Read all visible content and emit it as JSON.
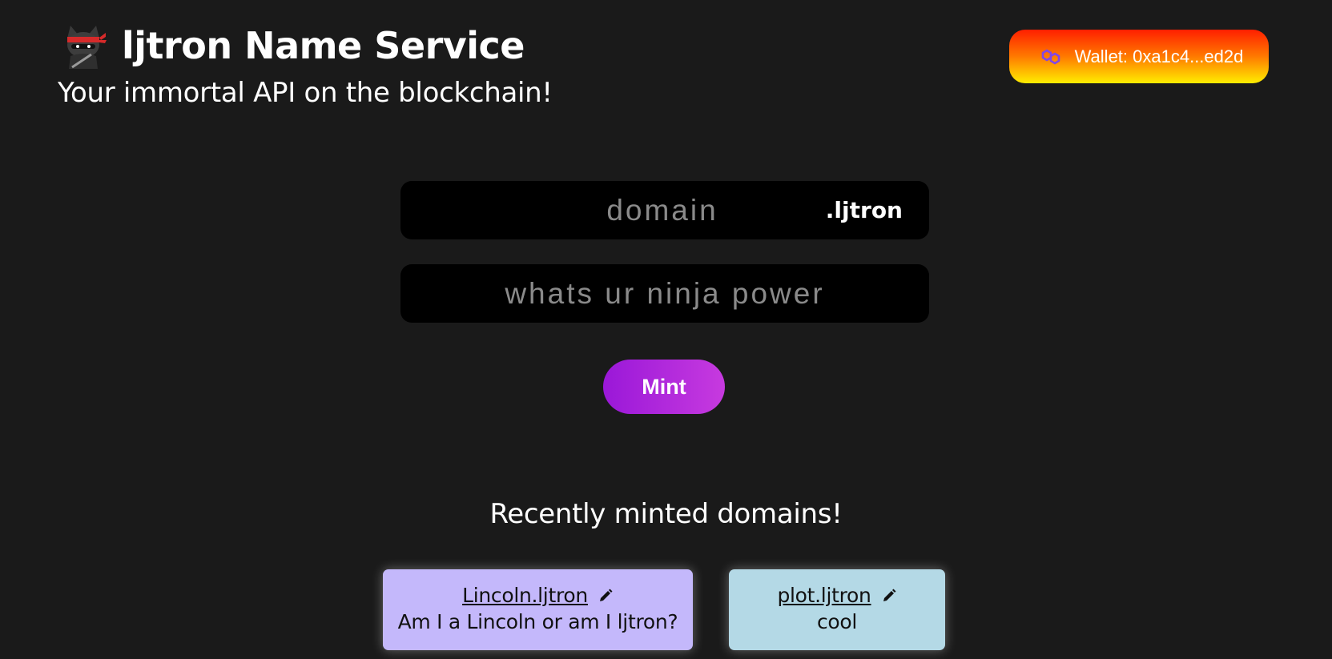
{
  "header": {
    "title": "ljtron Name Service",
    "subtitle": "Your immortal API on the blockchain!",
    "logo_icon": "ninja-cat-icon"
  },
  "wallet": {
    "label": "Wallet: 0xa1c4...ed2d",
    "icon": "polygon-icon",
    "gradient": [
      "#ff1f00",
      "#ff7a00",
      "#ffee00"
    ]
  },
  "form": {
    "domain_placeholder": "domain",
    "domain_value": "",
    "tld": ".ljtron",
    "record_placeholder": "whats ur ninja power",
    "record_value": "",
    "mint_label": "Mint",
    "mint_gradient": [
      "#9a18d8",
      "#c73adf"
    ]
  },
  "recent": {
    "title": "Recently minted domains!",
    "items": [
      {
        "name": "Lincoln.ljtron",
        "record": "Am I a Lincoln or am I ljtron?",
        "color": "#c4b8fb",
        "edit_icon": "pencil-icon"
      },
      {
        "name": "plot.ljtron",
        "record": "cool",
        "color": "#b4d9e6",
        "edit_icon": "pencil-icon"
      }
    ]
  },
  "colors": {
    "background": "#1a1a1a",
    "input_background": "#000000",
    "placeholder": "#8a8a8a"
  }
}
